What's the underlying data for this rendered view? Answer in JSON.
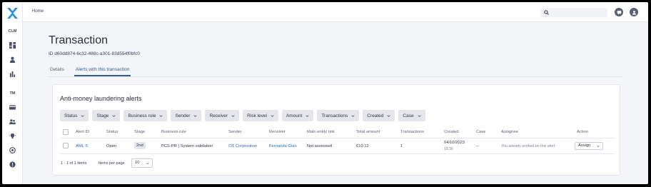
{
  "sidebar": {
    "sections": [
      {
        "label": "CLM",
        "items": [
          "dashboard-icon",
          "person-icon",
          "bar-chart-icon"
        ]
      },
      {
        "label": "TM",
        "items": [
          "bank-card-icon",
          "group-icon",
          "bulb-icon",
          "radar-icon",
          "alert-icon"
        ]
      }
    ]
  },
  "topbar": {
    "breadcrumb": "Home",
    "search_placeholder": ""
  },
  "page": {
    "title": "Transaction",
    "id_text": "ID d60dd874-6c32-488c-a301-83d554f0bfc0",
    "tabs": [
      {
        "label": "Details",
        "active": false
      },
      {
        "label": "Alerts with this transaction",
        "active": true
      }
    ]
  },
  "card": {
    "title": "Anti-money laundering alerts",
    "filters": [
      "Status",
      "Stage",
      "Business rule",
      "Sender",
      "Receiver",
      "Risk level",
      "Amount",
      "Transactions",
      "Created",
      "Case"
    ],
    "columns": [
      "Alert ID",
      "Status",
      "Stage",
      "Business rule",
      "Sender",
      "Receiver",
      "Main entity risk",
      "Total amount",
      "Transactions",
      "Created",
      "Case",
      "Assignee",
      "Action"
    ],
    "rows": [
      {
        "alert_id": "AML-5",
        "status": "Open",
        "stage": "2nd",
        "business_rule": "PCS-PR | System validation",
        "sender": "CR Corporation",
        "receiver": "Fernanda Gian",
        "main_entity_risk": "Not assessed",
        "total_amount": "€10.12",
        "transactions": "1",
        "created_date": "04/10/2023",
        "created_time": "18:30",
        "case": "--",
        "assignee": "You already worked on this alert",
        "action": "Assign"
      }
    ],
    "pagination": {
      "range": "1 - 1 of 1 items",
      "items_per_page_label": "Items per page",
      "page_size": "10"
    }
  },
  "colors": {
    "accent": "#2d5c8e",
    "link": "#2d6cb5",
    "logo": "#2f8fd8"
  }
}
